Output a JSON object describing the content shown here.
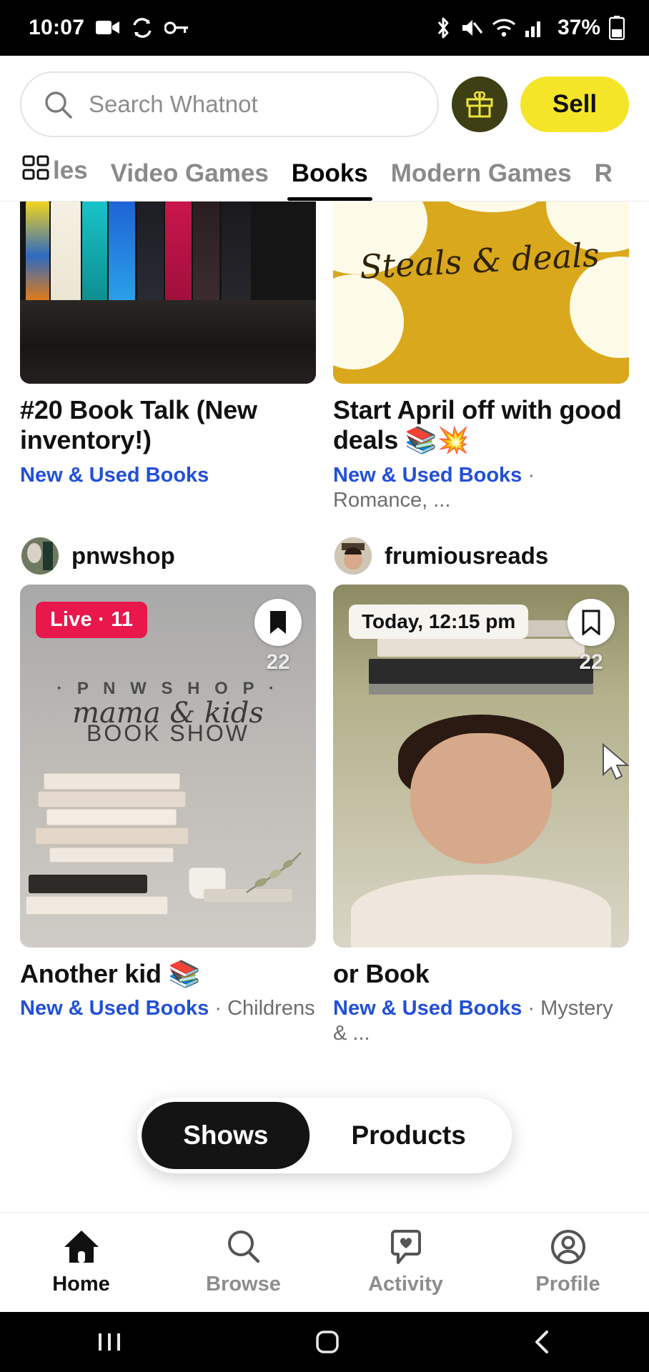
{
  "status_bar": {
    "time": "10:07",
    "battery_percent": "37%",
    "icons": [
      "camera-icon",
      "sync-icon",
      "key-icon",
      "bluetooth-icon",
      "mute-icon",
      "wifi-icon",
      "cell-signal-icon",
      "battery-icon"
    ]
  },
  "header": {
    "search_placeholder": "Search Whatnot",
    "search_icon": "search-icon",
    "gift_icon": "gift-icon",
    "sell_label": "Sell",
    "accent_yellow": "#F5E529",
    "gift_bg": "#3F3F15"
  },
  "category_tabs": {
    "grid_icon": "grid-icon",
    "items": [
      {
        "label": "les",
        "active": false,
        "clipped": true
      },
      {
        "label": "Video Games",
        "active": false,
        "clipped": false
      },
      {
        "label": "Books",
        "active": true,
        "clipped": false
      },
      {
        "label": "Modern Games",
        "active": false,
        "clipped": false
      },
      {
        "label": "R",
        "active": false,
        "clipped": false
      }
    ]
  },
  "feed": {
    "cards": [
      {
        "title": "#20 Book Talk (New inventory!)",
        "category": "New & Used Books",
        "subcategory": "",
        "seller": "",
        "badge": "",
        "bookmark_count": ""
      },
      {
        "title": "Start April off with good deals 📚💥",
        "category": "New & Used Books",
        "subcategory": "· Romance, ...",
        "seller": "",
        "badge": "",
        "bookmark_count": "",
        "art_text": "Steals & deals"
      },
      {
        "title": "Another kid 📚",
        "category": "New & Used Books",
        "subcategory": "· Childrens",
        "seller": "pnwshop",
        "badge": "Live · 11",
        "badge_type": "live",
        "bookmark_count": "22",
        "bookmark_icon": "bookmark-icon",
        "art_brand": "· P N W S H O P ·",
        "art_line1": "mama & kids",
        "art_line2": "BOOK SHOW"
      },
      {
        "title": "or Book",
        "category": "New & Used Books",
        "subcategory": "· Mystery & ...",
        "seller": "frumiousreads",
        "badge": "Today, 12:15 pm",
        "badge_type": "scheduled",
        "bookmark_count": "22",
        "bookmark_icon": "bookmark-icon"
      }
    ]
  },
  "segmented_control": {
    "options": [
      {
        "label": "Shows",
        "active": true
      },
      {
        "label": "Products",
        "active": false
      }
    ]
  },
  "bottom_nav": {
    "items": [
      {
        "label": "Home",
        "icon": "home-icon",
        "active": true
      },
      {
        "label": "Browse",
        "icon": "search-icon",
        "active": false
      },
      {
        "label": "Activity",
        "icon": "heart-bubble-icon",
        "active": false
      },
      {
        "label": "Profile",
        "icon": "person-circle-icon",
        "active": false
      }
    ]
  },
  "system_nav": {
    "recents_icon": "recents-icon",
    "home_icon": "home-square-icon",
    "back_icon": "back-chevron-icon"
  }
}
